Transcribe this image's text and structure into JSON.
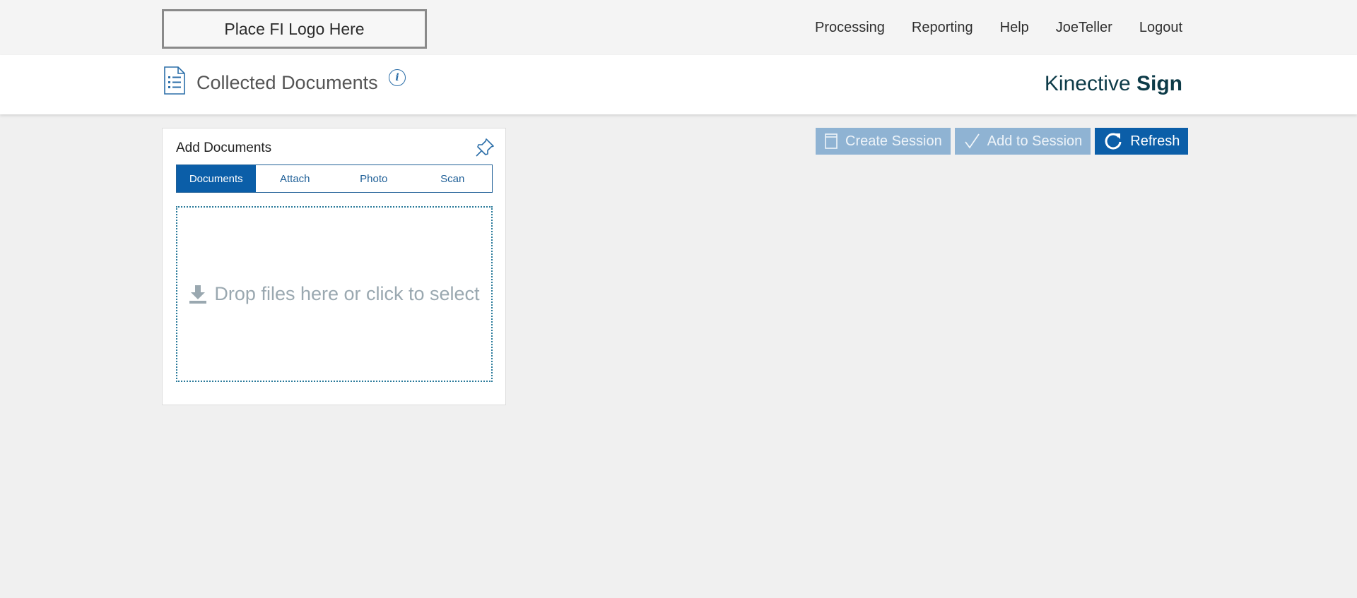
{
  "header": {
    "logo_text": "Place FI Logo Here",
    "nav": [
      "Processing",
      "Reporting",
      "Help",
      "JoeTeller",
      "Logout"
    ]
  },
  "subheader": {
    "title": "Collected Documents",
    "info_icon": "info-icon",
    "brand_light": "Kinective",
    "brand_bold": "Sign"
  },
  "panel": {
    "title": "Add Documents",
    "tabs": [
      "Documents",
      "Attach",
      "Photo",
      "Scan"
    ],
    "active_tab": "Documents",
    "dropzone_text": "Drop files here or click to select"
  },
  "actions": {
    "create_session": "Create Session",
    "add_to_session": "Add to Session",
    "refresh": "Refresh"
  },
  "colors": {
    "primary": "#0b5ea8",
    "disabled": "#8fb3d3",
    "brand": "#0d3b48"
  }
}
